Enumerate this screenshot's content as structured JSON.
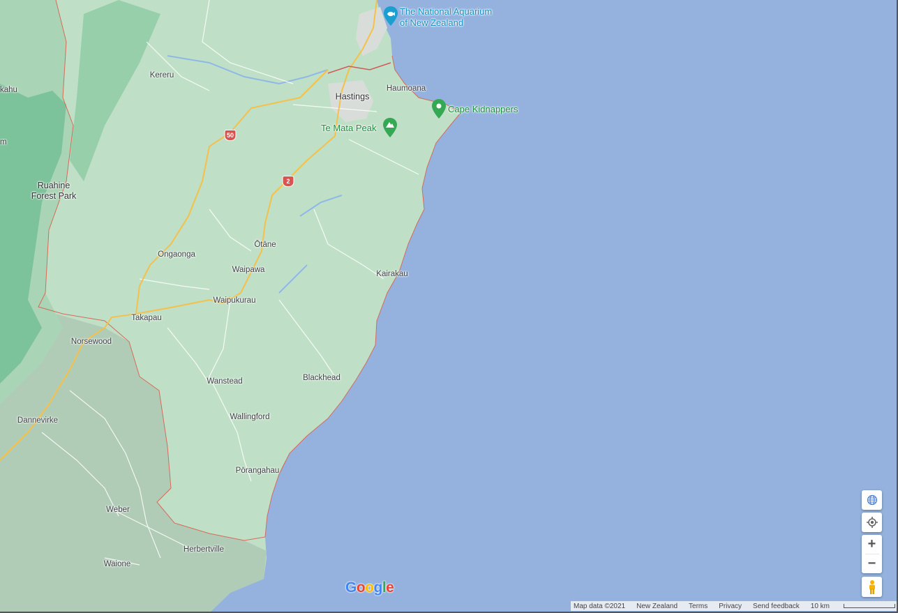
{
  "colors": {
    "water": "#94b2dd",
    "land_light": "#bfe0c6",
    "land_mid": "#aad4b6",
    "forest_dark": "#7cc29a",
    "region_grey": "#b0ccb7",
    "road_major": "#f5c04a",
    "road_minor": "#ffffff",
    "rail": "#cf5a5a",
    "boundary": "#d46b5a",
    "poi_green": "#1e8e3e",
    "poi_blue": "#1a8ebf"
  },
  "places": [
    {
      "id": "kereru",
      "name": "Kereru"
    },
    {
      "id": "hastings",
      "name": "Hastings"
    },
    {
      "id": "haumoana",
      "name": "Haumoana"
    },
    {
      "id": "ruahine",
      "name": "Ruahine\nForest Park"
    },
    {
      "id": "ongaonga",
      "name": "Ongaonga"
    },
    {
      "id": "otane",
      "name": "Ōtāne"
    },
    {
      "id": "waipawa",
      "name": "Waipawa"
    },
    {
      "id": "kairakau",
      "name": "Kairakau"
    },
    {
      "id": "waipukurau",
      "name": "Waipukurau"
    },
    {
      "id": "takapau",
      "name": "Takapau"
    },
    {
      "id": "norsewood",
      "name": "Norsewood"
    },
    {
      "id": "wanstead",
      "name": "Wanstead"
    },
    {
      "id": "blackhead",
      "name": "Blackhead"
    },
    {
      "id": "dannevirke",
      "name": "Dannevirke"
    },
    {
      "id": "wallingford",
      "name": "Wallingford"
    },
    {
      "id": "porangahau",
      "name": "Pōrangahau"
    },
    {
      "id": "weber",
      "name": "Weber"
    },
    {
      "id": "herbertville",
      "name": "Herbertville"
    },
    {
      "id": "waione",
      "name": "Waione"
    },
    {
      "id": "edge_kahu",
      "name": "kahu"
    },
    {
      "id": "edge_m",
      "name": "m"
    }
  ],
  "pois": [
    {
      "id": "aquarium",
      "name": "The National Aquarium\nof New Zealand",
      "icon": "aquarium-icon"
    },
    {
      "id": "cape",
      "name": "Cape Kidnappers",
      "icon": "map-pin-icon"
    },
    {
      "id": "temata",
      "name": "Te Mata Peak",
      "icon": "mountain-icon"
    }
  ],
  "route_shields": [
    {
      "id": "r50",
      "label": "50"
    },
    {
      "id": "r2",
      "label": "2"
    }
  ],
  "controls": {
    "globe": "globe-icon",
    "locate": "my-location-icon",
    "zoom_in": "+",
    "zoom_out": "−",
    "pegman": "pegman-icon"
  },
  "attribution": {
    "map_data": "Map data ©2021",
    "region": "New Zealand",
    "terms": "Terms",
    "privacy": "Privacy",
    "feedback": "Send feedback",
    "scale": "10 km"
  },
  "logo": "Google"
}
